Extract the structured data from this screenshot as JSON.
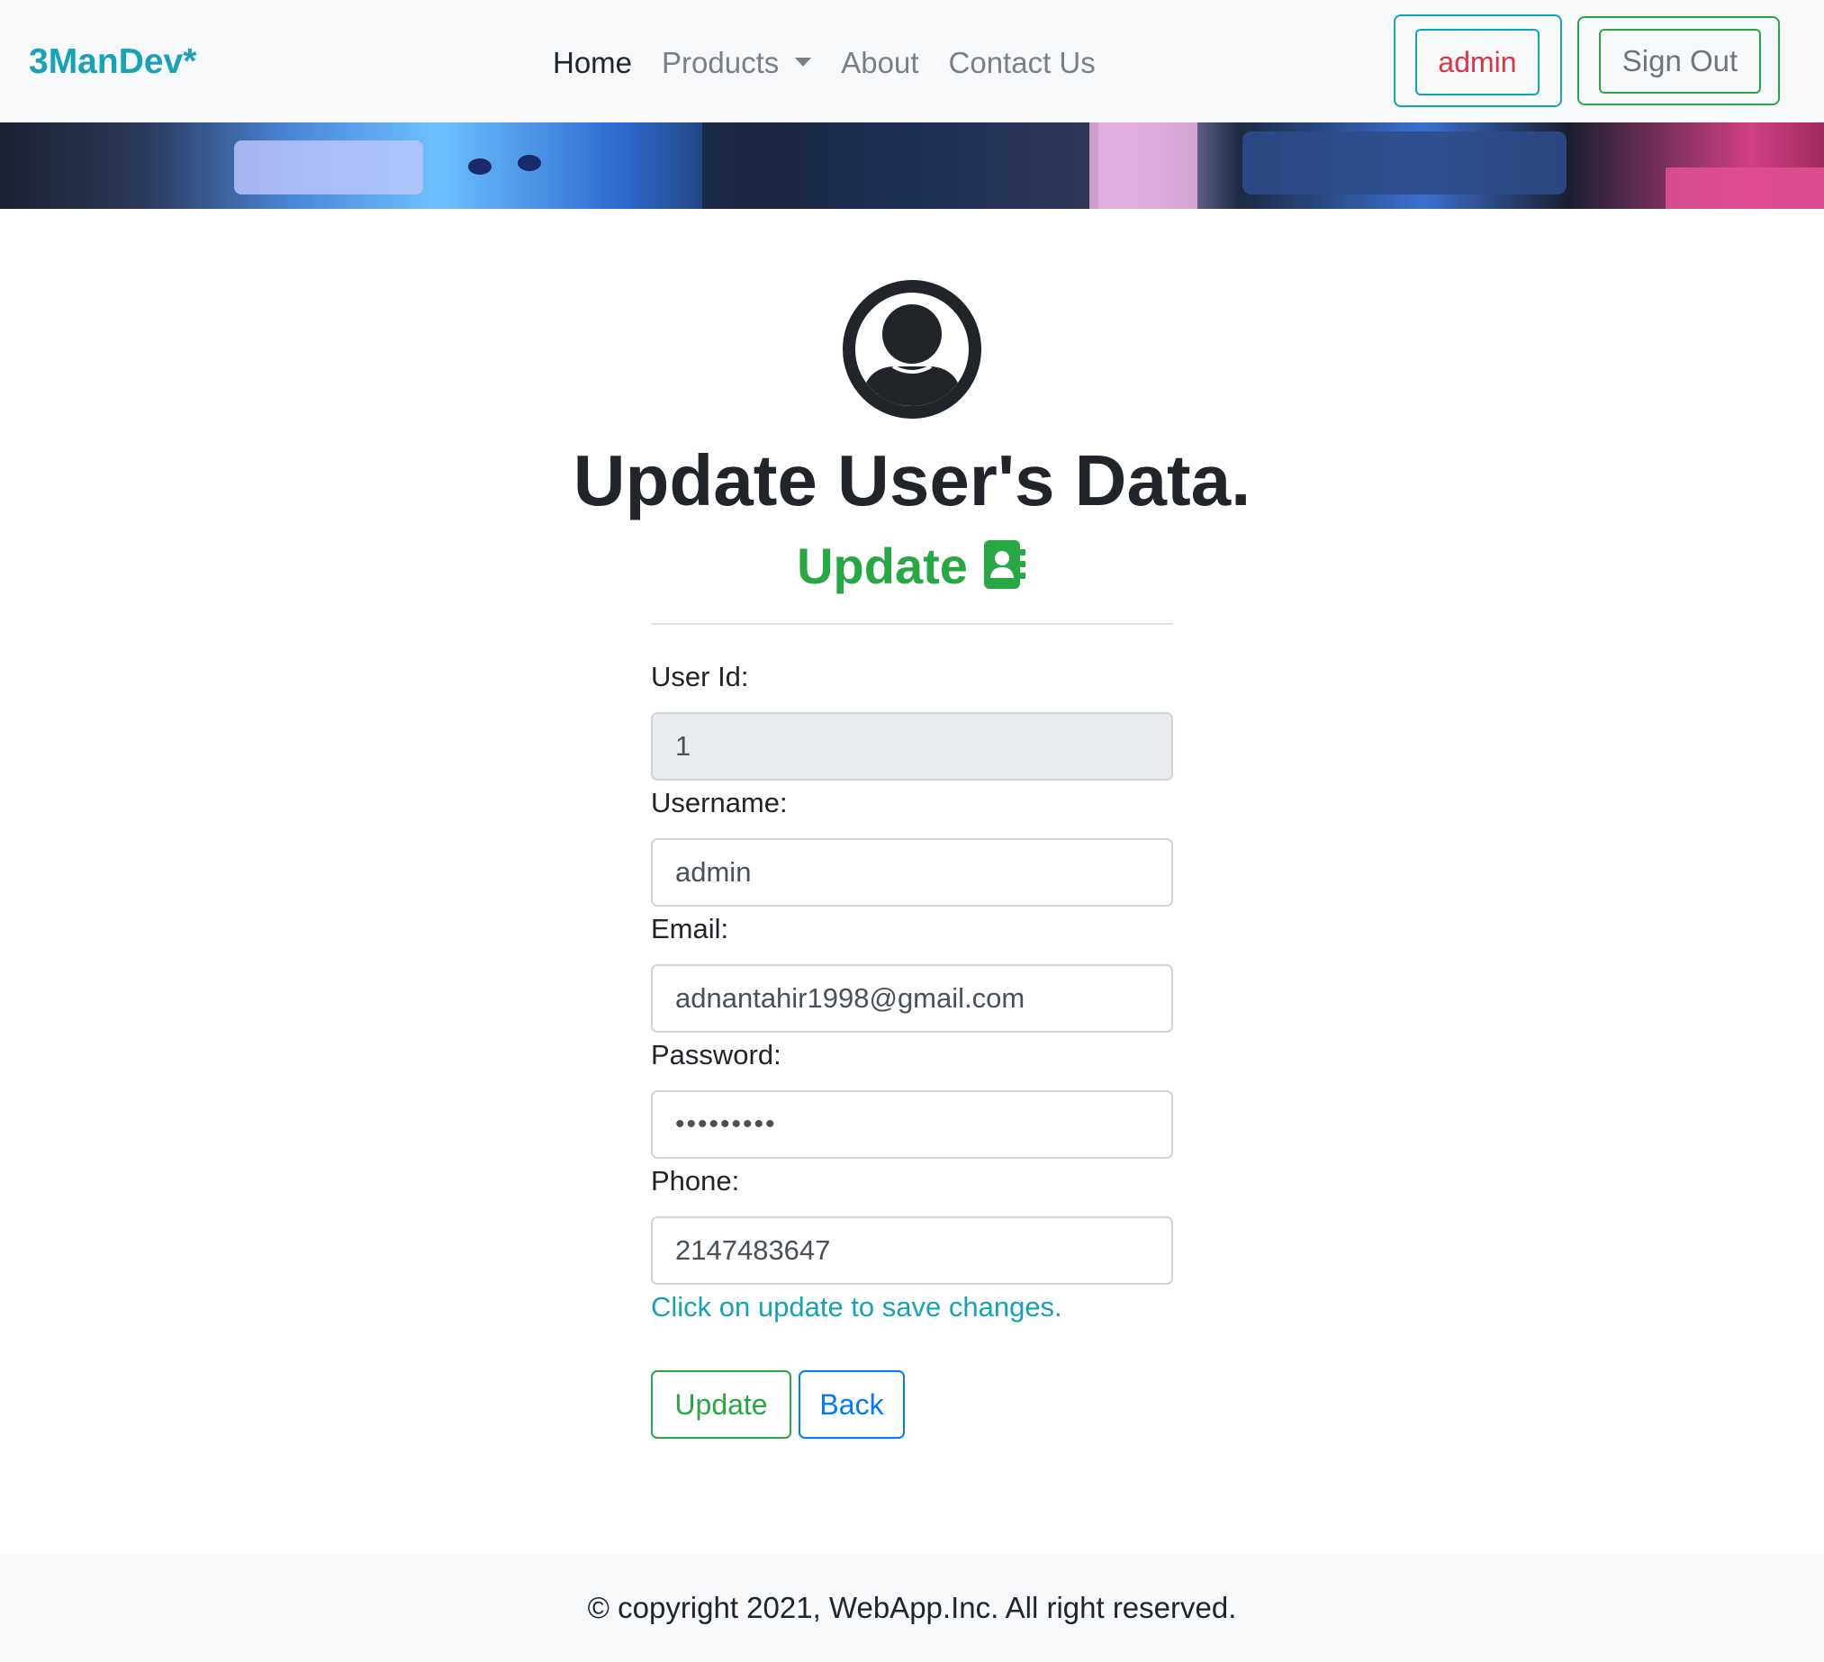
{
  "navbar": {
    "brand": "3ManDev*",
    "links": [
      {
        "label": "Home",
        "active": true
      },
      {
        "label": "Products",
        "dropdown": true
      },
      {
        "label": "About"
      },
      {
        "label": "Contact Us"
      }
    ],
    "user_button": "admin",
    "signout_button": "Sign Out"
  },
  "page": {
    "title": "Update User's Data.",
    "subtitle": "Update",
    "subtitle_icon": "address-book-icon",
    "avatar_icon": "user-circle-icon"
  },
  "form": {
    "user_id": {
      "label": "User Id:",
      "value": "1",
      "disabled": true
    },
    "username": {
      "label": "Username:",
      "value": "admin"
    },
    "email": {
      "label": "Email:",
      "value": "adnantahir1998@gmail.com"
    },
    "password": {
      "label": "Password:",
      "value": "•••••••••"
    },
    "phone": {
      "label": "Phone:",
      "value": "2147483647"
    },
    "hint": "Click on update to save changes.",
    "update_button": "Update",
    "back_button": "Back"
  },
  "footer": {
    "text": "© copyright 2021, WebApp.Inc. All right reserved."
  },
  "colors": {
    "brand": "#17a2b8",
    "success": "#28a745",
    "danger": "#dc3545",
    "primary": "#007bff",
    "navbar_bg": "#f8f9fa"
  }
}
